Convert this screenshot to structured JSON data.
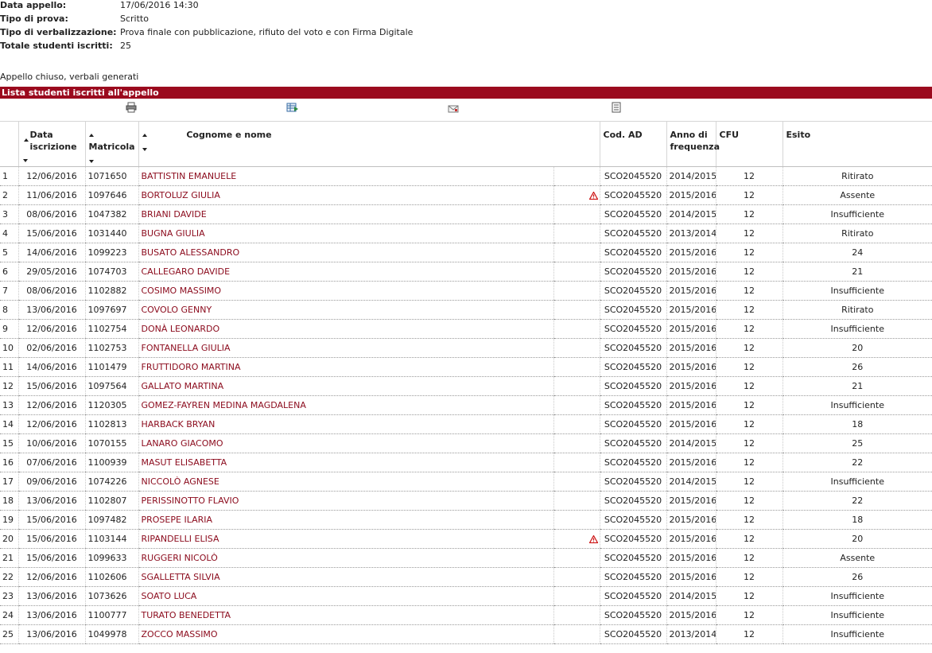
{
  "info": {
    "rows": [
      {
        "label": "Data appello:",
        "value": "17/06/2016 14:30"
      },
      {
        "label": "Tipo di prova:",
        "value": "Scritto"
      },
      {
        "label": "Tipo di verbalizzazione:",
        "value": "Prova finale con pubblicazione, rifiuto del voto e con Firma Digitale"
      },
      {
        "label": "Totale studenti iscritti:",
        "value": "25"
      }
    ]
  },
  "status": "Appello chiuso, verbali generati",
  "section_title": "Lista studenti iscritti all'appello",
  "toolbar": {
    "icons": [
      "printer-icon",
      "excel-export-icon",
      "email-icon",
      "document-list-icon"
    ]
  },
  "table": {
    "headers": {
      "data_line1": "Data",
      "data_line2": "iscrizione",
      "matricola": "Matricola",
      "nome": "Cognome e nome",
      "cod": "Cod. AD",
      "anno_line1": "Anno di",
      "anno_line2": "frequenza",
      "cfu": "CFU",
      "esito": "Esito"
    },
    "rows": [
      {
        "n": "1",
        "data": "12/06/2016",
        "matricola": "1071650",
        "nome": "BATTISTIN EMANUELE",
        "warn": false,
        "cod": "SCO2045520",
        "anno": "2014/2015",
        "cfu": "12",
        "esito": "Ritirato"
      },
      {
        "n": "2",
        "data": "11/06/2016",
        "matricola": "1097646",
        "nome": "BORTOLUZ GIULIA",
        "warn": true,
        "cod": "SCO2045520",
        "anno": "2015/2016",
        "cfu": "12",
        "esito": "Assente"
      },
      {
        "n": "3",
        "data": "08/06/2016",
        "matricola": "1047382",
        "nome": "BRIANI DAVIDE",
        "warn": false,
        "cod": "SCO2045520",
        "anno": "2014/2015",
        "cfu": "12",
        "esito": "Insufficiente"
      },
      {
        "n": "4",
        "data": "15/06/2016",
        "matricola": "1031440",
        "nome": "BUGNA GIULIA",
        "warn": false,
        "cod": "SCO2045520",
        "anno": "2013/2014",
        "cfu": "12",
        "esito": "Ritirato"
      },
      {
        "n": "5",
        "data": "14/06/2016",
        "matricola": "1099223",
        "nome": "BUSATO ALESSANDRO",
        "warn": false,
        "cod": "SCO2045520",
        "anno": "2015/2016",
        "cfu": "12",
        "esito": "24"
      },
      {
        "n": "6",
        "data": "29/05/2016",
        "matricola": "1074703",
        "nome": "CALLEGARO DAVIDE",
        "warn": false,
        "cod": "SCO2045520",
        "anno": "2015/2016",
        "cfu": "12",
        "esito": "21"
      },
      {
        "n": "7",
        "data": "08/06/2016",
        "matricola": "1102882",
        "nome": "COSIMO MASSIMO",
        "warn": false,
        "cod": "SCO2045520",
        "anno": "2015/2016",
        "cfu": "12",
        "esito": "Insufficiente"
      },
      {
        "n": "8",
        "data": "13/06/2016",
        "matricola": "1097697",
        "nome": "COVOLO GENNY",
        "warn": false,
        "cod": "SCO2045520",
        "anno": "2015/2016",
        "cfu": "12",
        "esito": "Ritirato"
      },
      {
        "n": "9",
        "data": "12/06/2016",
        "matricola": "1102754",
        "nome": "DONÀ LEONARDO",
        "warn": false,
        "cod": "SCO2045520",
        "anno": "2015/2016",
        "cfu": "12",
        "esito": "Insufficiente"
      },
      {
        "n": "10",
        "data": "02/06/2016",
        "matricola": "1102753",
        "nome": "FONTANELLA GIULIA",
        "warn": false,
        "cod": "SCO2045520",
        "anno": "2015/2016",
        "cfu": "12",
        "esito": "20"
      },
      {
        "n": "11",
        "data": "14/06/2016",
        "matricola": "1101479",
        "nome": "FRUTTIDORO MARTINA",
        "warn": false,
        "cod": "SCO2045520",
        "anno": "2015/2016",
        "cfu": "12",
        "esito": "26"
      },
      {
        "n": "12",
        "data": "15/06/2016",
        "matricola": "1097564",
        "nome": "GALLATO MARTINA",
        "warn": false,
        "cod": "SCO2045520",
        "anno": "2015/2016",
        "cfu": "12",
        "esito": "21"
      },
      {
        "n": "13",
        "data": "12/06/2016",
        "matricola": "1120305",
        "nome": "GOMEZ-FAYREN MEDINA MAGDALENA",
        "warn": false,
        "cod": "SCO2045520",
        "anno": "2015/2016",
        "cfu": "12",
        "esito": "Insufficiente"
      },
      {
        "n": "14",
        "data": "12/06/2016",
        "matricola": "1102813",
        "nome": "HARBACK BRYAN",
        "warn": false,
        "cod": "SCO2045520",
        "anno": "2015/2016",
        "cfu": "12",
        "esito": "18"
      },
      {
        "n": "15",
        "data": "10/06/2016",
        "matricola": "1070155",
        "nome": "LANARO GIACOMO",
        "warn": false,
        "cod": "SCO2045520",
        "anno": "2014/2015",
        "cfu": "12",
        "esito": "25"
      },
      {
        "n": "16",
        "data": "07/06/2016",
        "matricola": "1100939",
        "nome": "MASUT ELISABETTA",
        "warn": false,
        "cod": "SCO2045520",
        "anno": "2015/2016",
        "cfu": "12",
        "esito": "22"
      },
      {
        "n": "17",
        "data": "09/06/2016",
        "matricola": "1074226",
        "nome": "NICCOLÒ AGNESE",
        "warn": false,
        "cod": "SCO2045520",
        "anno": "2014/2015",
        "cfu": "12",
        "esito": "Insufficiente"
      },
      {
        "n": "18",
        "data": "13/06/2016",
        "matricola": "1102807",
        "nome": "PERISSINOTTO FLAVIO",
        "warn": false,
        "cod": "SCO2045520",
        "anno": "2015/2016",
        "cfu": "12",
        "esito": "22"
      },
      {
        "n": "19",
        "data": "15/06/2016",
        "matricola": "1097482",
        "nome": "PROSEPE ILARIA",
        "warn": false,
        "cod": "SCO2045520",
        "anno": "2015/2016",
        "cfu": "12",
        "esito": "18"
      },
      {
        "n": "20",
        "data": "15/06/2016",
        "matricola": "1103144",
        "nome": "RIPANDELLI ELISA",
        "warn": true,
        "cod": "SCO2045520",
        "anno": "2015/2016",
        "cfu": "12",
        "esito": "20"
      },
      {
        "n": "21",
        "data": "15/06/2016",
        "matricola": "1099633",
        "nome": "RUGGERI NICOLÒ",
        "warn": false,
        "cod": "SCO2045520",
        "anno": "2015/2016",
        "cfu": "12",
        "esito": "Assente"
      },
      {
        "n": "22",
        "data": "12/06/2016",
        "matricola": "1102606",
        "nome": "SGALLETTA SILVIA",
        "warn": false,
        "cod": "SCO2045520",
        "anno": "2015/2016",
        "cfu": "12",
        "esito": "26"
      },
      {
        "n": "23",
        "data": "13/06/2016",
        "matricola": "1073626",
        "nome": "SOATO LUCA",
        "warn": false,
        "cod": "SCO2045520",
        "anno": "2014/2015",
        "cfu": "12",
        "esito": "Insufficiente"
      },
      {
        "n": "24",
        "data": "13/06/2016",
        "matricola": "1100777",
        "nome": "TURATO BENEDETTA",
        "warn": false,
        "cod": "SCO2045520",
        "anno": "2015/2016",
        "cfu": "12",
        "esito": "Insufficiente"
      },
      {
        "n": "25",
        "data": "13/06/2016",
        "matricola": "1049978",
        "nome": "ZOCCO MASSIMO",
        "warn": false,
        "cod": "SCO2045520",
        "anno": "2013/2014",
        "cfu": "12",
        "esito": "Insufficiente"
      }
    ]
  },
  "colors": {
    "accent": "#9b0a1e",
    "name_link": "#8b0a1c",
    "warning": "#cc1111"
  }
}
